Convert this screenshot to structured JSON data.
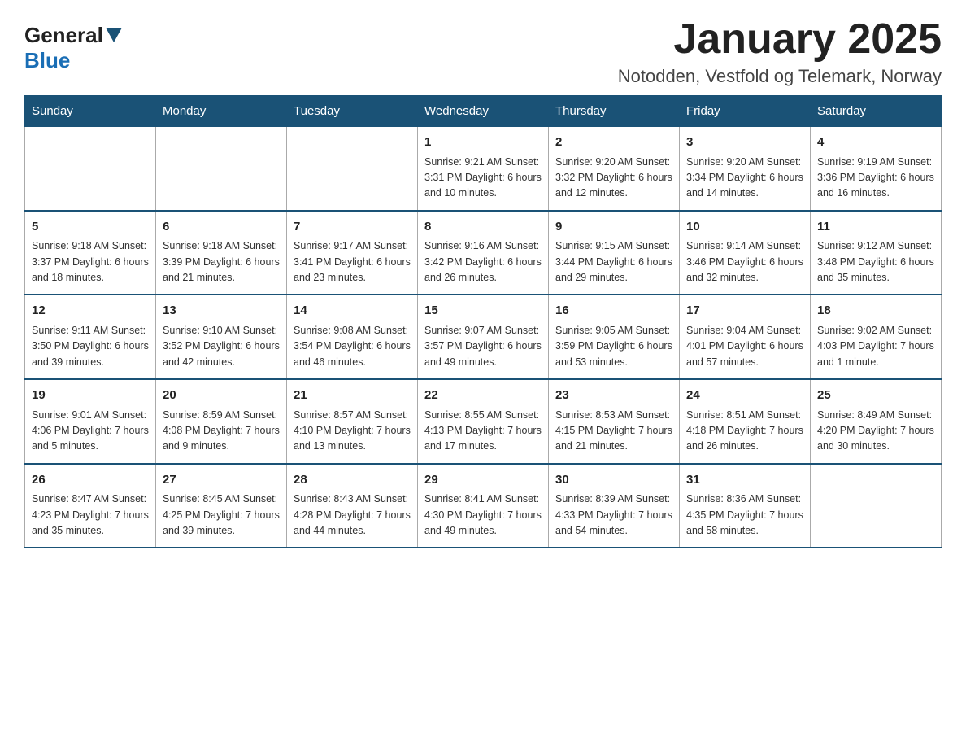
{
  "header": {
    "logo_general": "General",
    "logo_blue": "Blue",
    "title": "January 2025",
    "subtitle": "Notodden, Vestfold og Telemark, Norway"
  },
  "days_of_week": [
    "Sunday",
    "Monday",
    "Tuesday",
    "Wednesday",
    "Thursday",
    "Friday",
    "Saturday"
  ],
  "weeks": [
    [
      {
        "day": "",
        "info": ""
      },
      {
        "day": "",
        "info": ""
      },
      {
        "day": "",
        "info": ""
      },
      {
        "day": "1",
        "info": "Sunrise: 9:21 AM\nSunset: 3:31 PM\nDaylight: 6 hours\nand 10 minutes."
      },
      {
        "day": "2",
        "info": "Sunrise: 9:20 AM\nSunset: 3:32 PM\nDaylight: 6 hours\nand 12 minutes."
      },
      {
        "day": "3",
        "info": "Sunrise: 9:20 AM\nSunset: 3:34 PM\nDaylight: 6 hours\nand 14 minutes."
      },
      {
        "day": "4",
        "info": "Sunrise: 9:19 AM\nSunset: 3:36 PM\nDaylight: 6 hours\nand 16 minutes."
      }
    ],
    [
      {
        "day": "5",
        "info": "Sunrise: 9:18 AM\nSunset: 3:37 PM\nDaylight: 6 hours\nand 18 minutes."
      },
      {
        "day": "6",
        "info": "Sunrise: 9:18 AM\nSunset: 3:39 PM\nDaylight: 6 hours\nand 21 minutes."
      },
      {
        "day": "7",
        "info": "Sunrise: 9:17 AM\nSunset: 3:41 PM\nDaylight: 6 hours\nand 23 minutes."
      },
      {
        "day": "8",
        "info": "Sunrise: 9:16 AM\nSunset: 3:42 PM\nDaylight: 6 hours\nand 26 minutes."
      },
      {
        "day": "9",
        "info": "Sunrise: 9:15 AM\nSunset: 3:44 PM\nDaylight: 6 hours\nand 29 minutes."
      },
      {
        "day": "10",
        "info": "Sunrise: 9:14 AM\nSunset: 3:46 PM\nDaylight: 6 hours\nand 32 minutes."
      },
      {
        "day": "11",
        "info": "Sunrise: 9:12 AM\nSunset: 3:48 PM\nDaylight: 6 hours\nand 35 minutes."
      }
    ],
    [
      {
        "day": "12",
        "info": "Sunrise: 9:11 AM\nSunset: 3:50 PM\nDaylight: 6 hours\nand 39 minutes."
      },
      {
        "day": "13",
        "info": "Sunrise: 9:10 AM\nSunset: 3:52 PM\nDaylight: 6 hours\nand 42 minutes."
      },
      {
        "day": "14",
        "info": "Sunrise: 9:08 AM\nSunset: 3:54 PM\nDaylight: 6 hours\nand 46 minutes."
      },
      {
        "day": "15",
        "info": "Sunrise: 9:07 AM\nSunset: 3:57 PM\nDaylight: 6 hours\nand 49 minutes."
      },
      {
        "day": "16",
        "info": "Sunrise: 9:05 AM\nSunset: 3:59 PM\nDaylight: 6 hours\nand 53 minutes."
      },
      {
        "day": "17",
        "info": "Sunrise: 9:04 AM\nSunset: 4:01 PM\nDaylight: 6 hours\nand 57 minutes."
      },
      {
        "day": "18",
        "info": "Sunrise: 9:02 AM\nSunset: 4:03 PM\nDaylight: 7 hours\nand 1 minute."
      }
    ],
    [
      {
        "day": "19",
        "info": "Sunrise: 9:01 AM\nSunset: 4:06 PM\nDaylight: 7 hours\nand 5 minutes."
      },
      {
        "day": "20",
        "info": "Sunrise: 8:59 AM\nSunset: 4:08 PM\nDaylight: 7 hours\nand 9 minutes."
      },
      {
        "day": "21",
        "info": "Sunrise: 8:57 AM\nSunset: 4:10 PM\nDaylight: 7 hours\nand 13 minutes."
      },
      {
        "day": "22",
        "info": "Sunrise: 8:55 AM\nSunset: 4:13 PM\nDaylight: 7 hours\nand 17 minutes."
      },
      {
        "day": "23",
        "info": "Sunrise: 8:53 AM\nSunset: 4:15 PM\nDaylight: 7 hours\nand 21 minutes."
      },
      {
        "day": "24",
        "info": "Sunrise: 8:51 AM\nSunset: 4:18 PM\nDaylight: 7 hours\nand 26 minutes."
      },
      {
        "day": "25",
        "info": "Sunrise: 8:49 AM\nSunset: 4:20 PM\nDaylight: 7 hours\nand 30 minutes."
      }
    ],
    [
      {
        "day": "26",
        "info": "Sunrise: 8:47 AM\nSunset: 4:23 PM\nDaylight: 7 hours\nand 35 minutes."
      },
      {
        "day": "27",
        "info": "Sunrise: 8:45 AM\nSunset: 4:25 PM\nDaylight: 7 hours\nand 39 minutes."
      },
      {
        "day": "28",
        "info": "Sunrise: 8:43 AM\nSunset: 4:28 PM\nDaylight: 7 hours\nand 44 minutes."
      },
      {
        "day": "29",
        "info": "Sunrise: 8:41 AM\nSunset: 4:30 PM\nDaylight: 7 hours\nand 49 minutes."
      },
      {
        "day": "30",
        "info": "Sunrise: 8:39 AM\nSunset: 4:33 PM\nDaylight: 7 hours\nand 54 minutes."
      },
      {
        "day": "31",
        "info": "Sunrise: 8:36 AM\nSunset: 4:35 PM\nDaylight: 7 hours\nand 58 minutes."
      },
      {
        "day": "",
        "info": ""
      }
    ]
  ]
}
